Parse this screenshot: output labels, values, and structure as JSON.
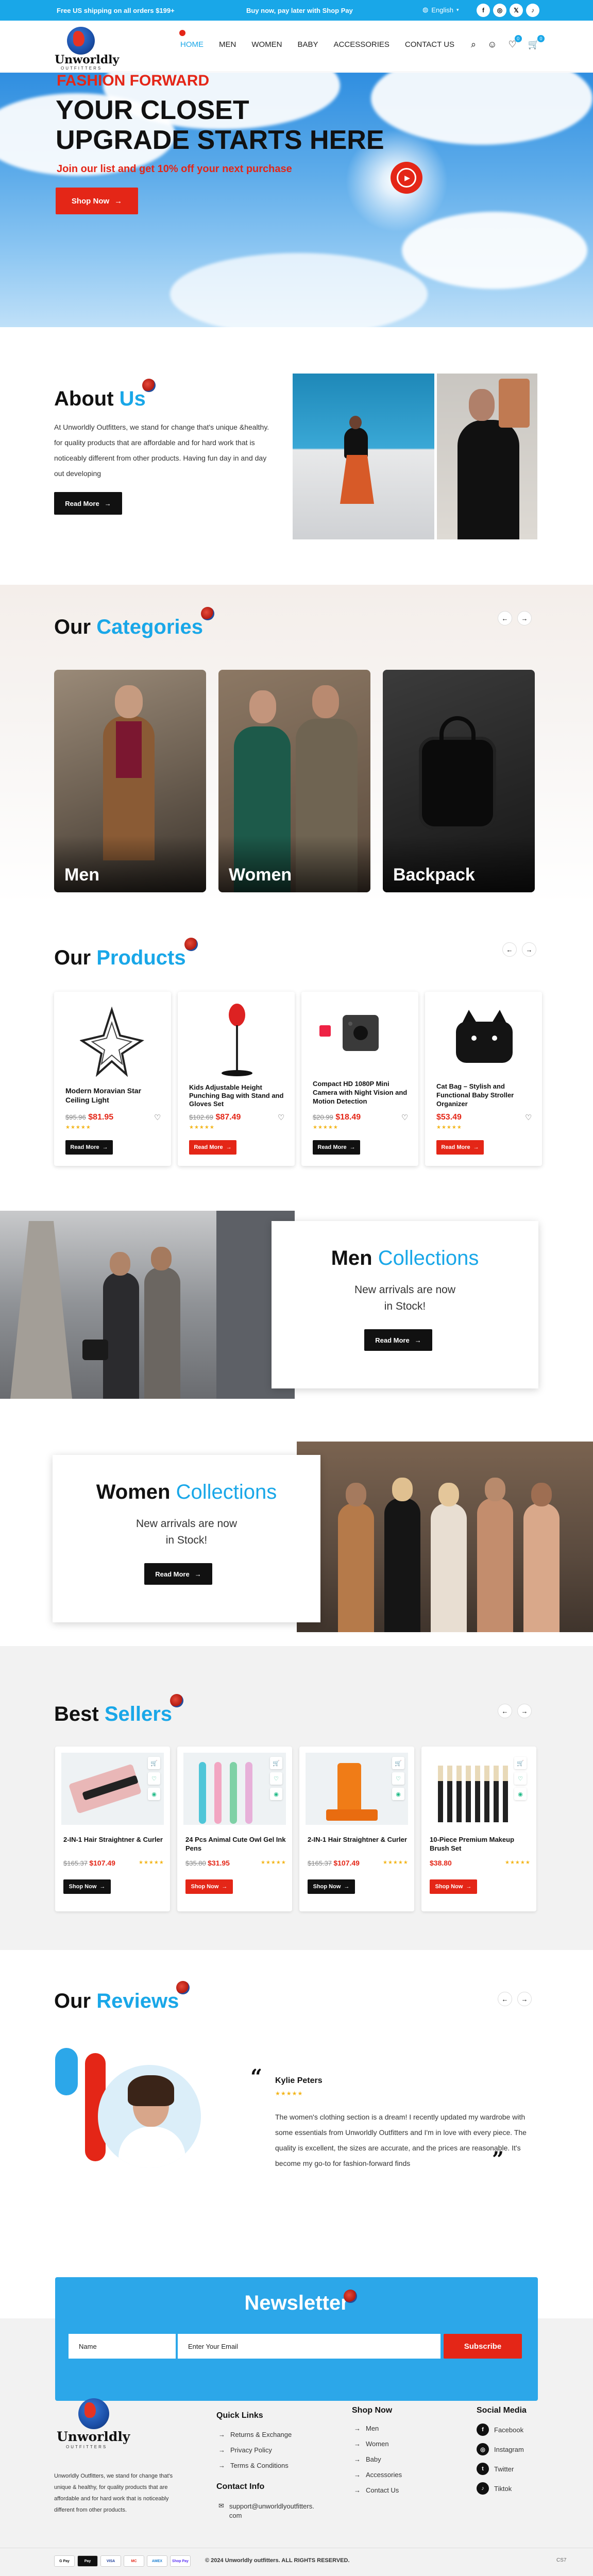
{
  "topbar": {
    "promo_left": "Free US shipping on all orders $199+",
    "promo_center": "Buy now, pay later with Shop Pay",
    "language": "English",
    "social_icons": [
      "facebook-icon",
      "instagram-icon",
      "x-icon",
      "tiktok-icon"
    ]
  },
  "header": {
    "logo_name": "Unworldly",
    "logo_tagline": "OUTFITTERS",
    "nav": [
      "HOME",
      "MEN",
      "WOMEN",
      "BABY",
      "ACCESSORIES",
      "CONTACT US"
    ],
    "wishlist_count": "0",
    "cart_count": "0"
  },
  "hero": {
    "eyebrow": "FASHION FORWARD",
    "title": "YOUR CLOSET UPGRADE STARTS HERE",
    "subtitle": "Join our list and get 10% off your next purchase",
    "cta": "Shop Now",
    "cta_arrow": "→"
  },
  "about": {
    "title_a": "About",
    "title_b": "Us",
    "text": "At Unworldly Outfitters, we stand for change that's unique &healthy. for quality products that are affordable and for hard work that is noticeably different from other products. Having fun day in and day out developing",
    "cta": "Read More",
    "cta_arrow": "→"
  },
  "categories": {
    "title_a": "Our",
    "title_b": "Categories",
    "prev": "←",
    "next": "→",
    "items": [
      {
        "label": "Men"
      },
      {
        "label": "Women"
      },
      {
        "label": "Backpack"
      }
    ]
  },
  "products": {
    "title_a": "Our",
    "title_b": "Products",
    "prev": "←",
    "next": "→",
    "items": [
      {
        "name": "Modern Moravian Star Ceiling Light",
        "old": "$95.96",
        "new": "$81.95",
        "stars": "★★★★★",
        "button": "Read More",
        "button_color": "#111111"
      },
      {
        "name": "Kids Adjustable Height Punching Bag with Stand and Gloves Set",
        "old": "$102.69",
        "new": "$87.49",
        "stars": "★★★★★",
        "button": "Read More",
        "button_color": "#e42617"
      },
      {
        "name": "Compact HD 1080P Mini Camera with Night Vision and Motion Detection",
        "old": "$20.99",
        "new": "$18.49",
        "stars": "★★★★★",
        "button": "Read More",
        "button_color": "#111111"
      },
      {
        "name": "Cat Bag – Stylish and Functional Baby Stroller Organizer",
        "old": "",
        "new": "$53.49",
        "stars": "★★★★★",
        "button": "Read More",
        "button_color": "#e42617"
      }
    ]
  },
  "men_collection": {
    "title_a": "Men",
    "title_b": "Collections",
    "line1": "New arrivals are now",
    "line2": "in Stock!",
    "cta": "Read More",
    "cta_arrow": "→"
  },
  "women_collection": {
    "title_a": "Women",
    "title_b": "Collections",
    "line1": "New arrivals are now",
    "line2": "in Stock!",
    "cta": "Read More",
    "cta_arrow": "→"
  },
  "best_sellers": {
    "title_a": "Best",
    "title_b": "Sellers",
    "prev": "←",
    "next": "→",
    "items": [
      {
        "name": "2-IN-1 Hair Straightner & Curler",
        "old": "$165.37",
        "new": "$107.49",
        "stars": "★★★★★",
        "button": "Shop Now",
        "button_color": "#111111"
      },
      {
        "name": "24 Pcs Animal Cute Owl Gel Ink Pens",
        "old": "$35.80",
        "new": "$31.95",
        "stars": "★★★★★",
        "button": "Shop Now",
        "button_color": "#e42617"
      },
      {
        "name": "2-IN-1 Hair Straightner & Curler",
        "old": "$165.37",
        "new": "$107.49",
        "stars": "★★★★★",
        "button": "Shop Now",
        "button_color": "#111111"
      },
      {
        "name": "10-Piece Premium Makeup Brush Set",
        "old": "",
        "new": "$38.80",
        "stars": "★★★★★",
        "button": "Shop Now",
        "button_color": "#e42617"
      }
    ]
  },
  "reviews": {
    "title_a": "Our",
    "title_b": "Reviews",
    "prev": "←",
    "next": "→",
    "reviewer": "Kylie Peters",
    "stars": "★★★★★",
    "text": "The women's clothing section is a dream! I recently updated my wardrobe with some essentials from Unworldly Outfitters and I'm in love with every piece. The quality is excellent, the sizes are accurate, and the prices are reasonable. It's become my go-to for fashion-forward finds"
  },
  "newsletter": {
    "title": "Newsletter",
    "name_placeholder": "Name",
    "email_placeholder": "Enter Your Email",
    "button": "Subscribe"
  },
  "footer": {
    "logo_name": "Unworldly",
    "logo_tagline": "OUTFITTERS",
    "about": "Unworldly Outfitters, we stand for change that's unique & healthy, for quality products that are affordable and for hard work that is noticeably different from other products.",
    "quick_links_title": "Quick Links",
    "quick_links": [
      "Returns & Exchange",
      "Privacy Policy",
      "Terms & Conditions"
    ],
    "contact_title": "Contact Info",
    "contact_email": "support@unworldlyoutfitters.com",
    "shop_title": "Shop Now",
    "shop_links": [
      "Men",
      "Women",
      "Baby",
      "Accessories",
      "Contact Us"
    ],
    "social_title": "Social Media",
    "social_links": [
      "Facebook",
      "Instagram",
      "Twitter",
      "Tiktok"
    ],
    "payment_methods": [
      "G Pay",
      "Pay",
      "VISA",
      "MC",
      "AMEX",
      "Shop Pay"
    ],
    "copyright": "© 2024 Unworldly outfitters. ALL RIGHTS RESERVED.",
    "corner": "CS7"
  },
  "colors": {
    "accent": "#19a7e8",
    "red": "#e42617",
    "dark": "#111111",
    "grey_bg": "#f2f2f2"
  }
}
